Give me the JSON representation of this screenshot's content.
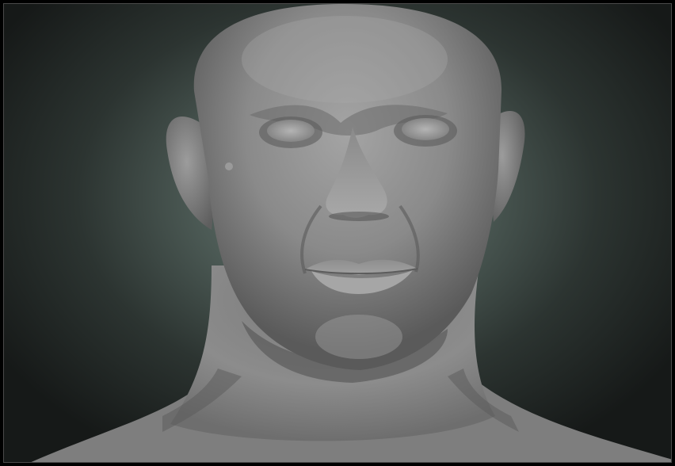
{
  "scene": {
    "subject": "sculpted-male-head-bust",
    "material_color": "#8c8c8c",
    "background_center_color": "#6a7a74",
    "background_edge_color": "#161918",
    "frame_border_color": "#4a4a4a"
  }
}
